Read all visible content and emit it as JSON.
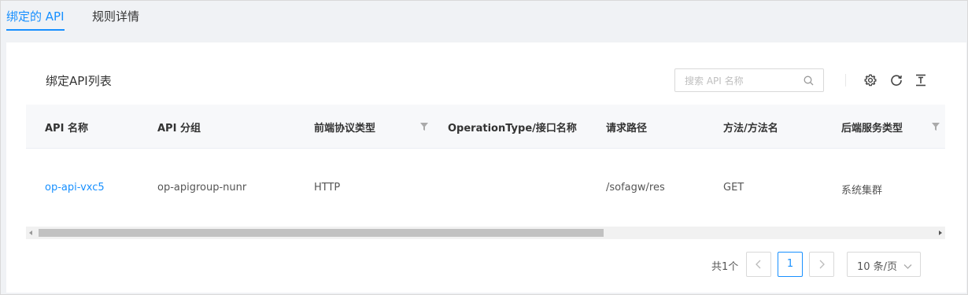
{
  "tabs": [
    {
      "label": "绑定的 API",
      "active": true
    },
    {
      "label": "规则详情",
      "active": false
    }
  ],
  "section_title": "绑定API列表",
  "search": {
    "placeholder": "搜索 API 名称",
    "value": ""
  },
  "toolbar": {
    "icons": [
      "gear-icon",
      "refresh-icon",
      "export-icon"
    ]
  },
  "table": {
    "columns": [
      {
        "label": "API 名称",
        "filter": false
      },
      {
        "label": "API 分组",
        "filter": false
      },
      {
        "label": "前端协议类型",
        "filter": true
      },
      {
        "label": "OperationType/接口名称",
        "filter": false
      },
      {
        "label": "请求路径",
        "filter": false
      },
      {
        "label": "方法/方法名",
        "filter": false
      },
      {
        "label": "后端服务类型",
        "filter": true
      }
    ],
    "rows": [
      {
        "api_name": "op-api-vxc5",
        "api_group": "op-apigroup-nunr",
        "protocol": "HTTP",
        "operation_type": "",
        "path": "/sofagw/res",
        "method": "GET",
        "backend": "系统集群"
      }
    ]
  },
  "pagination": {
    "total_text": "共1个",
    "current_page": "1",
    "page_size": "10 条/页"
  },
  "colors": {
    "accent": "#1890ff",
    "page_bg": "#f0f2f5",
    "header_bg": "#f7f8fa"
  }
}
